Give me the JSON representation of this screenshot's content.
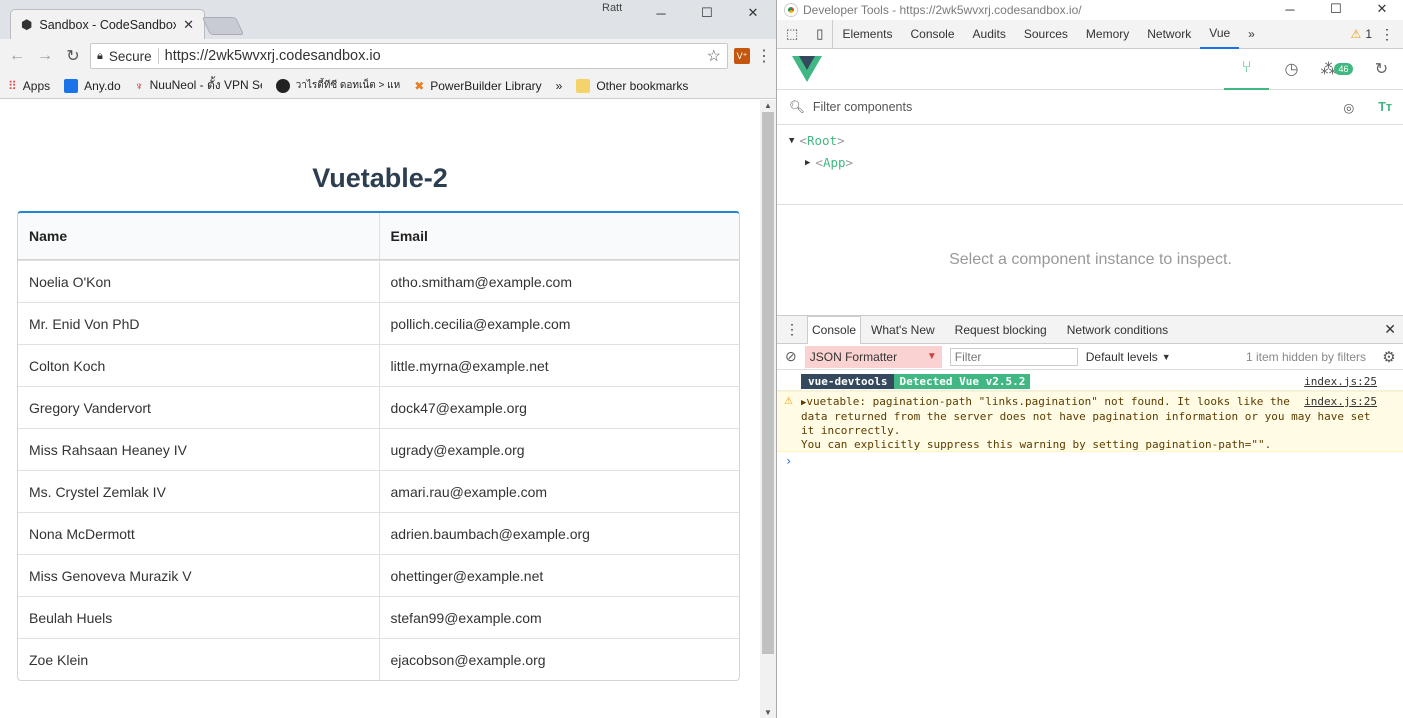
{
  "browser": {
    "tab_title": "Sandbox - CodeSandbox",
    "profile": "Ratt",
    "window_controls": {
      "minimize": "─",
      "maximize": "☐",
      "close": "✕"
    },
    "secure_label": "Secure",
    "url": "https://2wk5wvxrj.codesandbox.io",
    "extension_label": "V⁺",
    "bookmarks": [
      "Apps",
      "Any.do",
      "NuuNeol - ตั้ง VPN Se",
      "วาไรตี้ทีซี ดอทเน็ต > แห",
      "PowerBuilder Library",
      "»",
      "Other bookmarks"
    ]
  },
  "page": {
    "heading": "Vuetable-2",
    "table": {
      "columns": [
        "Name",
        "Email"
      ],
      "rows": [
        [
          "Noelia O'Kon",
          "otho.smitham@example.com"
        ],
        [
          "Mr. Enid Von PhD",
          "pollich.cecilia@example.com"
        ],
        [
          "Colton Koch",
          "little.myrna@example.net"
        ],
        [
          "Gregory Vandervort",
          "dock47@example.org"
        ],
        [
          "Miss Rahsaan Heaney IV",
          "ugrady@example.org"
        ],
        [
          "Ms. Crystel Zemlak IV",
          "amari.rau@example.com"
        ],
        [
          "Nona McDermott",
          "adrien.baumbach@example.org"
        ],
        [
          "Miss Genoveva Murazik V",
          "ohettinger@example.net"
        ],
        [
          "Beulah Huels",
          "stefan99@example.com"
        ],
        [
          "Zoe Klein",
          "ejacobson@example.org"
        ]
      ]
    }
  },
  "devtools": {
    "title": "Developer Tools - https://2wk5wvxrj.codesandbox.io/",
    "tabs": [
      "Elements",
      "Console",
      "Audits",
      "Sources",
      "Memory",
      "Network",
      "Vue",
      "»"
    ],
    "active_tab": "Vue",
    "warning_count": "1",
    "vue_badge": "46",
    "filter_placeholder": "Filter components",
    "text_size_icon": "Tт",
    "tree": {
      "root": "Root",
      "child": "App"
    },
    "select_message": "Select a component instance to inspect.",
    "drawer_tabs": [
      "Console",
      "What's New",
      "Request blocking",
      "Network conditions"
    ],
    "context": "JSON Formatter",
    "filter_label": "Filter",
    "levels": "Default levels",
    "hidden_text": "1 item hidden by filters",
    "messages": {
      "tag1": "vue-devtools",
      "tag2": "Detected Vue v2.5.2",
      "src1": "index.js:25",
      "warning_lines": [
        "vuetable: pagination-path \"links.pagination\" not found. It looks like the",
        "data returned from the server does not have pagination information or you may have set",
        "it incorrectly.",
        "You can explicitly suppress this warning by setting pagination-path=\"\"."
      ],
      "src2": "index.js:25",
      "prompt": "›"
    }
  },
  "colors": {
    "vue_green": "#41b883",
    "vue_dark": "#35495e",
    "table_accent": "#2185d0"
  }
}
